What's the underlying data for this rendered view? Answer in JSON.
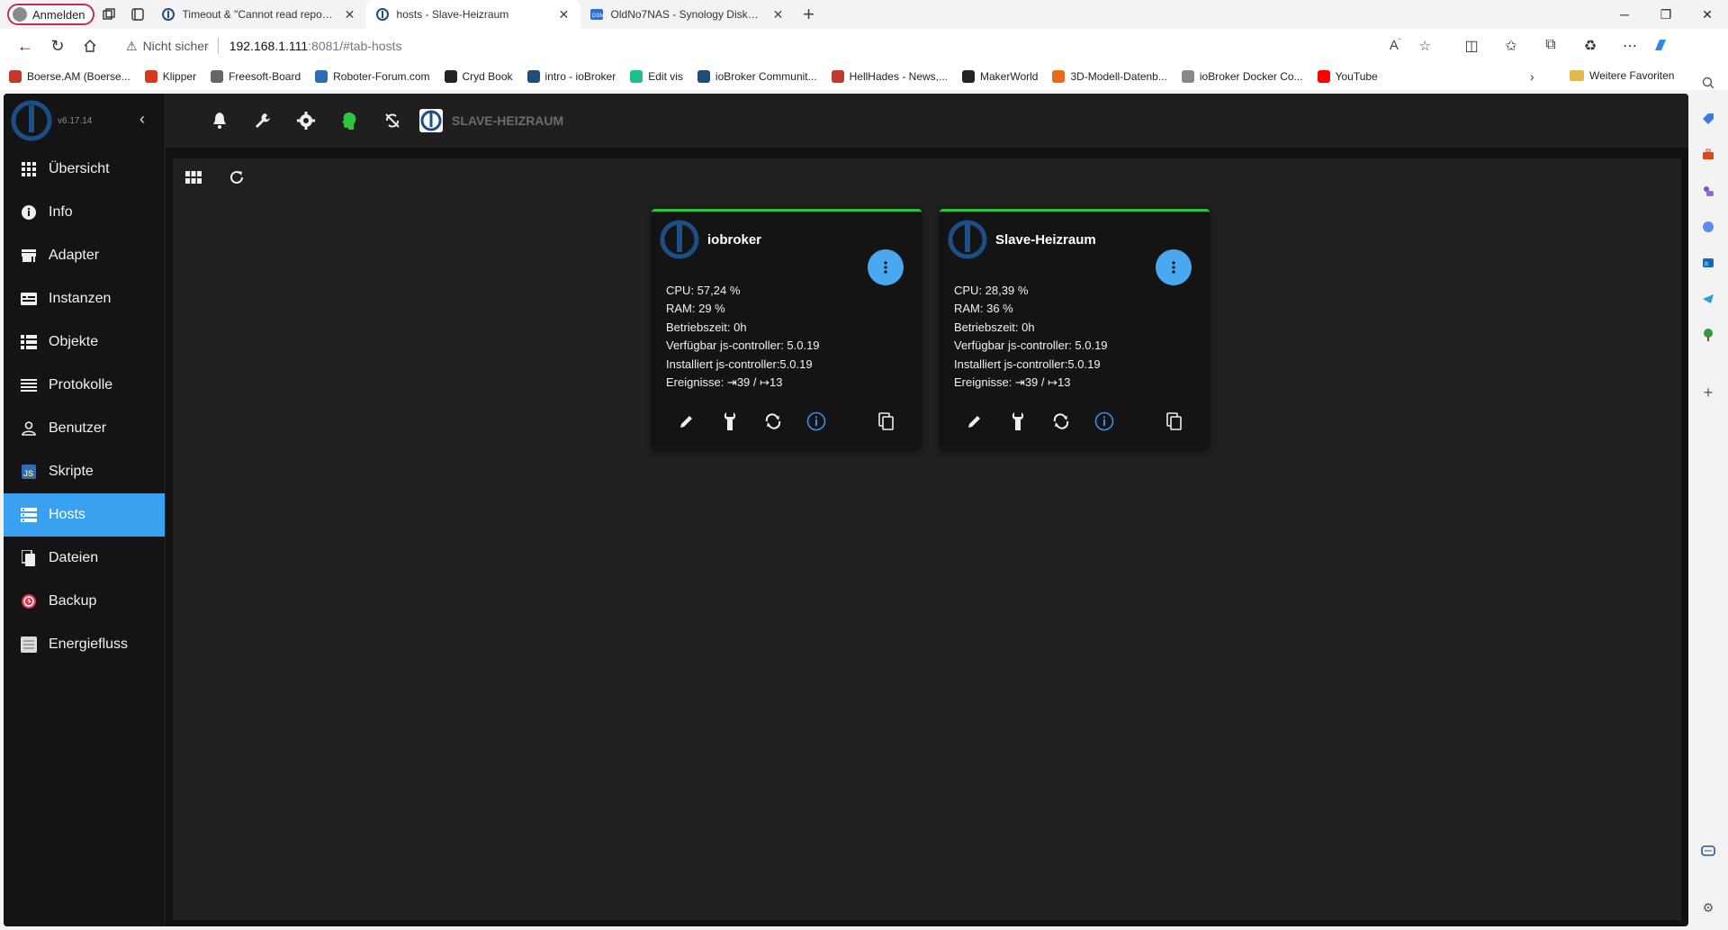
{
  "browser": {
    "profile_label": "Anmelden",
    "tabs": [
      {
        "title": "Timeout & \"Cannot read repository\"",
        "icon": "iobroker-forum-icon"
      },
      {
        "title": "hosts - Slave-Heizraum",
        "icon": "iobroker-icon"
      },
      {
        "title": "OldNo7NAS - Synology DiskStation",
        "icon": "dsm-icon"
      }
    ],
    "not_secure_label": "Nicht sicher",
    "url_host": "192.168.1.111",
    "url_rest": ":8081/#tab-hosts",
    "bookmarks": [
      {
        "label": "Boerse.AM (Boerse...",
        "color": "#c0392b"
      },
      {
        "label": "Klipper",
        "color": "#d9381e"
      },
      {
        "label": "Freesoft-Board",
        "color": "#666666"
      },
      {
        "label": "Roboter-Forum.com",
        "color": "#2d6db4"
      },
      {
        "label": "Cryd Book",
        "color": "#222222"
      },
      {
        "label": "intro - ioBroker",
        "color": "#1f4e79"
      },
      {
        "label": "Edit vis",
        "color": "#1bc08c"
      },
      {
        "label": "ioBroker Communit...",
        "color": "#1f4e79"
      },
      {
        "label": "HellHades - News,...",
        "color": "#c0392b"
      },
      {
        "label": "MakerWorld",
        "color": "#222222"
      },
      {
        "label": "3D-Modell-Datenb...",
        "color": "#e86a17"
      },
      {
        "label": "ioBroker Docker Co...",
        "color": "#888888"
      },
      {
        "label": "YouTube",
        "color": "#ff0000"
      }
    ],
    "favorites_label": "Weitere Favoriten"
  },
  "app": {
    "version": "v6.17.14",
    "menu": [
      {
        "label": "Übersicht",
        "icon": "apps-grid-icon",
        "active": false
      },
      {
        "label": "Info",
        "icon": "info-icon",
        "active": false
      },
      {
        "label": "Adapter",
        "icon": "store-icon",
        "active": false
      },
      {
        "label": "Instanzen",
        "icon": "instances-icon",
        "active": false
      },
      {
        "label": "Objekte",
        "icon": "list-icon",
        "active": false
      },
      {
        "label": "Protokolle",
        "icon": "lines-icon",
        "active": false
      },
      {
        "label": "Benutzer",
        "icon": "user-icon",
        "active": false
      },
      {
        "label": "Skripte",
        "icon": "js-icon",
        "active": false
      },
      {
        "label": "Hosts",
        "icon": "hosts-icon",
        "active": true
      },
      {
        "label": "Dateien",
        "icon": "files-icon",
        "active": false
      },
      {
        "label": "Backup",
        "icon": "backup-icon",
        "active": false
      },
      {
        "label": "Energiefluss",
        "icon": "energy-icon",
        "active": false
      }
    ],
    "current_host": "SLAVE-HEIZRAUM",
    "hosts": [
      {
        "name": "iobroker",
        "cpu": "CPU: 57,24 %",
        "ram": "RAM: 29 %",
        "uptime": "Betriebszeit: 0h",
        "available": "Verfügbar js-controller: 5.0.19",
        "installed": "Installiert js-controller:5.0.19",
        "events": "Ereignisse: ⇥39 / ↦13"
      },
      {
        "name": "Slave-Heizraum",
        "cpu": "CPU: 28,39 %",
        "ram": "RAM: 36 %",
        "uptime": "Betriebszeit: 0h",
        "available": "Verfügbar js-controller: 5.0.19",
        "installed": "Installiert js-controller:5.0.19",
        "events": "Ereignisse: ⇥39 / ↦13"
      }
    ],
    "colors": {
      "accent": "#3aa0f0",
      "alive": "#2ec43c",
      "logo": "#1c4f86"
    }
  }
}
